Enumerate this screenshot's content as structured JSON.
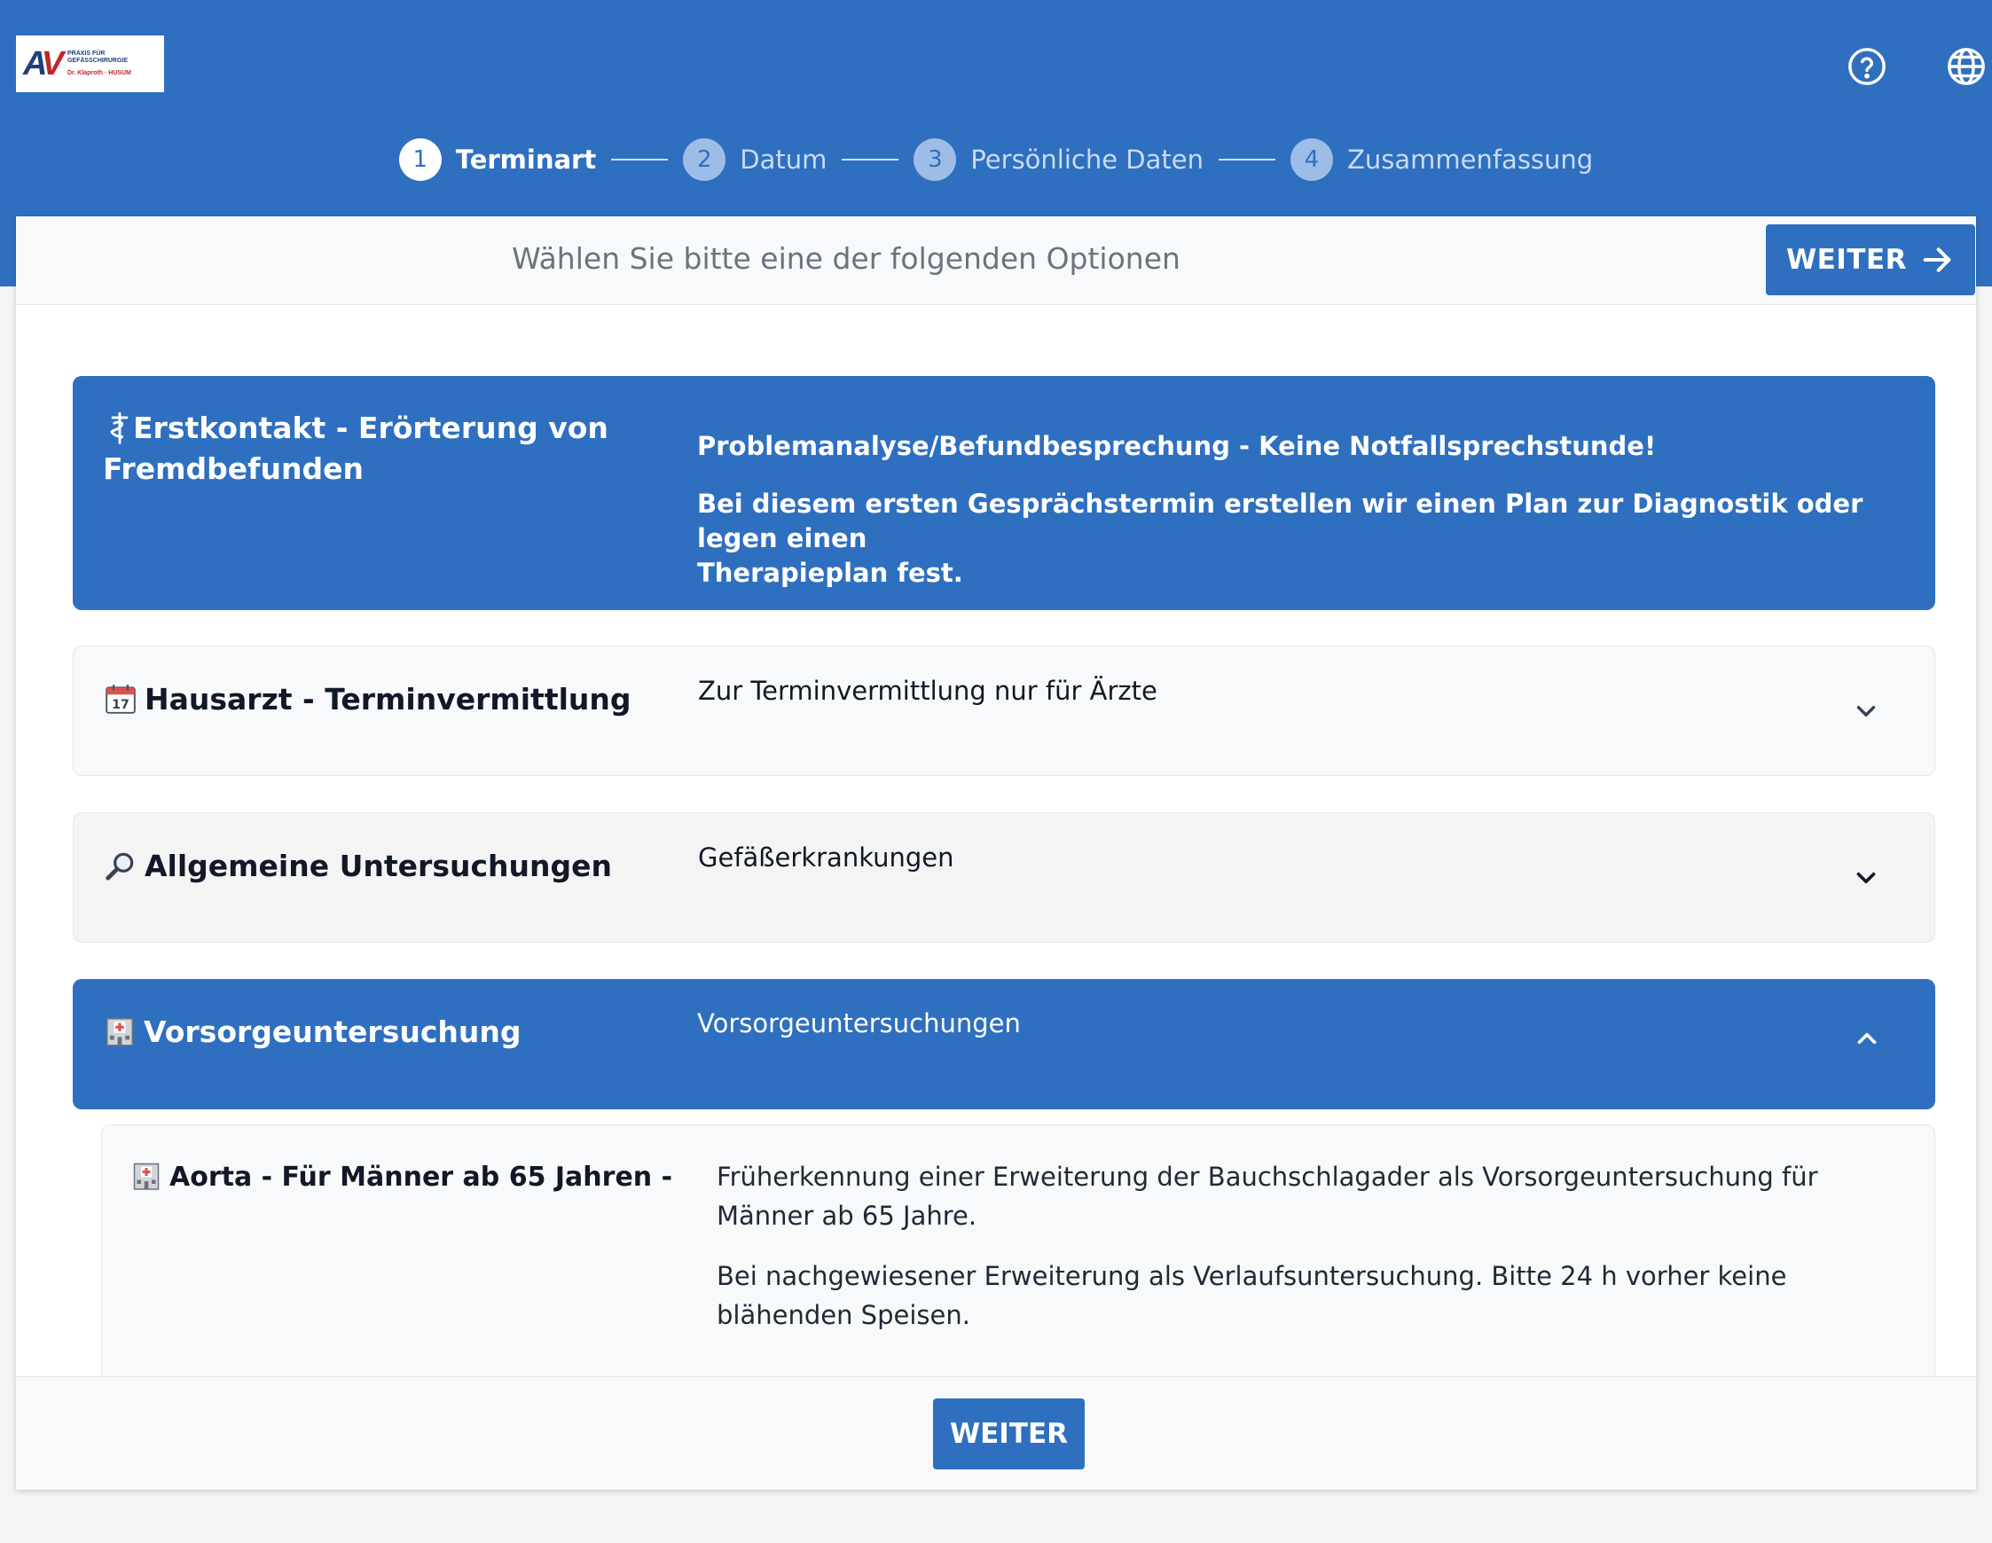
{
  "logo": {
    "line1": "PRAXIS FÜR",
    "line2": "GEFÄSSCHIRURGIE",
    "line3": "Dr. Klaproth · HUSUM"
  },
  "header_icons": [
    "help-icon",
    "globe-icon"
  ],
  "stepper": {
    "steps": [
      {
        "number": "1",
        "label": "Terminart",
        "active": true
      },
      {
        "number": "2",
        "label": "Datum",
        "active": false
      },
      {
        "number": "3",
        "label": "Persönliche Daten",
        "active": false
      },
      {
        "number": "4",
        "label": "Zusammenfassung",
        "active": false
      }
    ]
  },
  "card": {
    "instruction": "Wählen Sie bitte eine der folgenden Optionen",
    "next_label": "WEITER"
  },
  "options": [
    {
      "title_line1": "Erstkontakt - Erörterung von",
      "title_line2": "Fremdbefunden",
      "desc_line1": "Problemanalyse/Befundbesprechung - Keine Notfallsprechstunde!",
      "desc_line2": "Bei diesem ersten Gesprächstermin erstellen wir einen Plan zur Diagnostik oder legen einen",
      "desc_line3": "Therapieplan fest.",
      "icon": "caduceus-icon",
      "selected": true
    },
    {
      "title": "Hausarzt - Terminvermittlung",
      "desc": "Zur Terminvermittlung nur für Ärzte",
      "icon": "calendar-icon",
      "expanded": false
    },
    {
      "title": "Allgemeine Untersuchungen",
      "desc": "Gefäßerkrankungen",
      "icon": "magnifier-icon",
      "expanded": false
    },
    {
      "title": "Vorsorgeuntersuchung",
      "desc": "Vorsorgeuntersuchungen",
      "icon": "hospital-icon",
      "expanded": true
    }
  ],
  "sub_option": {
    "title": "Aorta - Für Männer ab 65 Jahren -",
    "icon": "hospital-icon",
    "desc_p1": "Früherkennung einer Erweiterung der Bauchschlagader als Vorsorgeuntersuchung für Männer ab 65 Jahre.",
    "desc_p2": "Bei nachgewiesener Erweiterung als Verlaufsuntersuchung. Bitte 24 h vorher keine blähenden Speisen."
  },
  "footer": {
    "next_label": "WEITER"
  }
}
